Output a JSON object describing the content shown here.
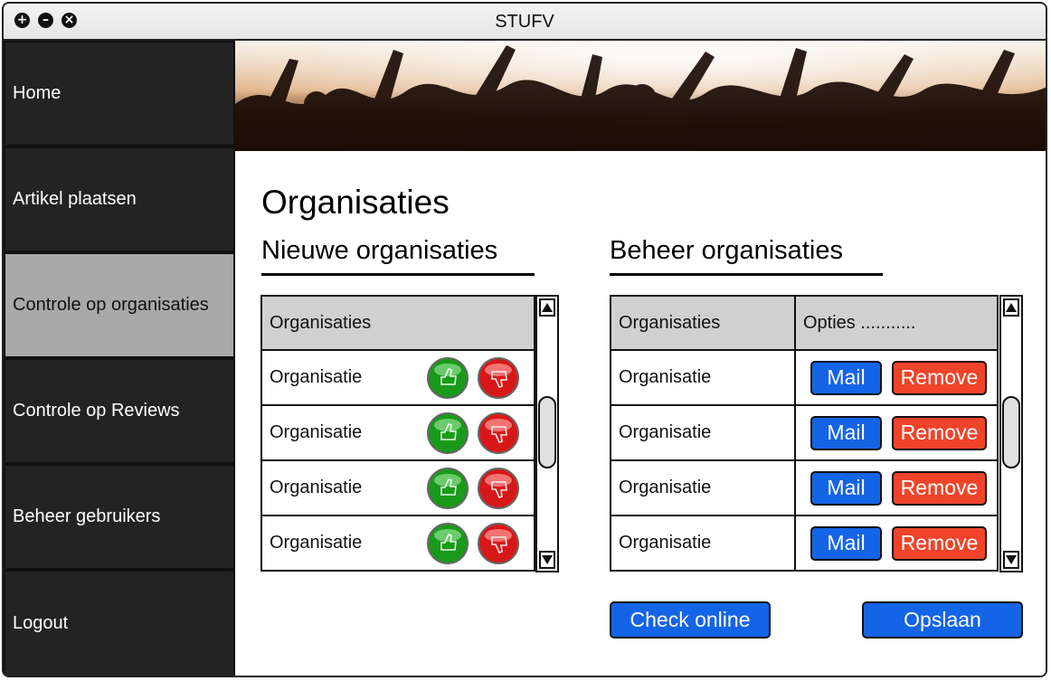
{
  "window": {
    "title": "STUFV"
  },
  "sidebar": {
    "items": [
      {
        "label": "Home"
      },
      {
        "label": "Artikel plaatsen"
      },
      {
        "label": "Controle op organisaties",
        "active": true
      },
      {
        "label": "Controle op Reviews"
      },
      {
        "label": "Beheer gebruikers"
      },
      {
        "label": "Logout"
      }
    ]
  },
  "main": {
    "page_title": "Organisaties",
    "new_section": {
      "title": "Nieuwe organisaties",
      "header": "Organisaties",
      "rows": [
        "Organisatie",
        "Organisatie",
        "Organisatie",
        "Organisatie"
      ]
    },
    "manage_section": {
      "title": "Beheer organisaties",
      "headers": [
        "Organisaties",
        "Opties ..........."
      ],
      "rows": [
        "Organisatie",
        "Organisatie",
        "Organisatie",
        "Organisatie"
      ],
      "mail_label": "Mail",
      "remove_label": "Remove"
    },
    "check_online_label": "Check online",
    "save_label": "Opslaan"
  },
  "colors": {
    "sidebar_bg": "#232323",
    "sidebar_active": "#a9a9a9",
    "primary_button": "#1464e6",
    "danger_button": "#f0442a",
    "approve_icon": "#1a9a1a",
    "reject_icon": "#d81818",
    "table_header": "#d0d0d0"
  },
  "icons": [
    "add-window-icon",
    "minimize-window-icon",
    "close-window-icon",
    "thumbs-up-icon",
    "thumbs-down-icon",
    "scroll-up-icon",
    "scroll-down-icon"
  ]
}
